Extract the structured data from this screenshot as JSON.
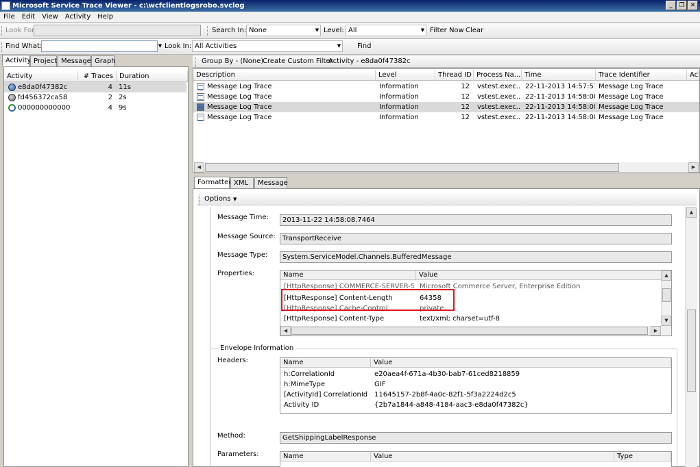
{
  "window": {
    "title": "Microsoft Service Trace Viewer - c:\\wcfclientlogsrobo.svclog"
  },
  "menu": [
    "File",
    "Edit",
    "View",
    "Activity",
    "Help"
  ],
  "toolbar1": {
    "look_for_label": "Look For",
    "look_for_value": "",
    "search_in_label": "Search In:",
    "search_in_value": "None",
    "level_label": "Level:",
    "level_value": "All",
    "filter_now": "Filter Now",
    "clear": "Clear"
  },
  "toolbar2": {
    "find_what_label": "Find What:",
    "find_what_value": "",
    "look_in_label": "Look In:",
    "look_in_value": "All Activities",
    "find": "Find"
  },
  "left_tabs": [
    "Activity",
    "Project",
    "Message",
    "Graph"
  ],
  "activity_table": {
    "headers": [
      "Activity",
      "# Traces",
      "Duration"
    ],
    "rows": [
      {
        "name": "e8da0f47382c",
        "traces": "4",
        "duration": "11s",
        "icon": "activity-icon"
      },
      {
        "name": "fd456372ca58",
        "traces": "2",
        "duration": "2s",
        "icon": "activity-icon"
      },
      {
        "name": "000000000000",
        "traces": "4",
        "duration": "9s",
        "icon": "refresh-activity-icon"
      }
    ]
  },
  "group_bar": {
    "group_by": "Group By - (None)",
    "custom_filter": "Create Custom Filter",
    "activity": "Activity - e8da0f47382c"
  },
  "trace_table": {
    "headers": [
      "Description",
      "Level",
      "Thread ID",
      "Process Na...",
      "Time",
      "Trace Identifier",
      "Acti"
    ],
    "rows": [
      {
        "description": "Message Log Trace",
        "level": "Information",
        "thread": "12",
        "process": "vstest.exec...",
        "time": "22-11-2013 14:57:57...",
        "identifier": "Message Log Trace"
      },
      {
        "description": "Message Log Trace",
        "level": "Information",
        "thread": "12",
        "process": "vstest.exec...",
        "time": "22-11-2013 14:58:00...",
        "identifier": "Message Log Trace"
      },
      {
        "description": "Message Log Trace",
        "level": "Information",
        "thread": "12",
        "process": "vstest.exec...",
        "time": "22-11-2013 14:58:08...",
        "identifier": "Message Log Trace"
      },
      {
        "description": "Message Log Trace",
        "level": "Information",
        "thread": "12",
        "process": "vstest.exec...",
        "time": "22-11-2013 14:58:08...",
        "identifier": "Message Log Trace"
      }
    ]
  },
  "detail_tabs": [
    "Formatted",
    "XML",
    "Message"
  ],
  "options_label": "Options",
  "details": {
    "message_time_label": "Message Time:",
    "message_time": "2013-11-22 14:58:08.7464",
    "message_source_label": "Message Source:",
    "message_source": "TransportReceive",
    "message_type_label": "Message Type:",
    "message_type": "System.ServiceModel.Channels.BufferedMessage",
    "properties_label": "Properties:",
    "properties_headers": [
      "Name",
      "Value"
    ],
    "properties_rows": [
      {
        "name": "[HttpResponse] COMMERCE-SERVER-SO...",
        "value": "Microsoft Commerce Server, Enterprise Edition"
      },
      {
        "name": "[HttpResponse] Content-Length",
        "value": "64358"
      },
      {
        "name": "[HttpResponse] Cache-Control",
        "value": "private"
      },
      {
        "name": "[HttpResponse] Content-Type",
        "value": "text/xml; charset=utf-8"
      }
    ],
    "envelope_label": "Envelope Information",
    "headers_label": "Headers:",
    "headers_headers": [
      "Name",
      "Value"
    ],
    "headers_rows": [
      {
        "name": "h:CorrelationId",
        "value": "e20aea4f-671a-4b30-bab7-61ced8218859"
      },
      {
        "name": "h:MimeType",
        "value": "GIF"
      },
      {
        "name": "[ActivityId] CorrelationId",
        "value": "11645157-2b8f-4a0c-82f1-5f3a2224d2c5"
      },
      {
        "name": "Activity ID",
        "value": "{2b7a1844-a848-4184-aac3-e8da0f47382c}"
      }
    ],
    "method_label": "Method:",
    "method": "GetShippingLabelResponse",
    "parameters_label": "Parameters:",
    "parameters_headers": [
      "Name",
      "Value",
      "Type"
    ]
  },
  "colors": {
    "highlight_box": "#e0141e",
    "title_start": "#0a246a"
  }
}
